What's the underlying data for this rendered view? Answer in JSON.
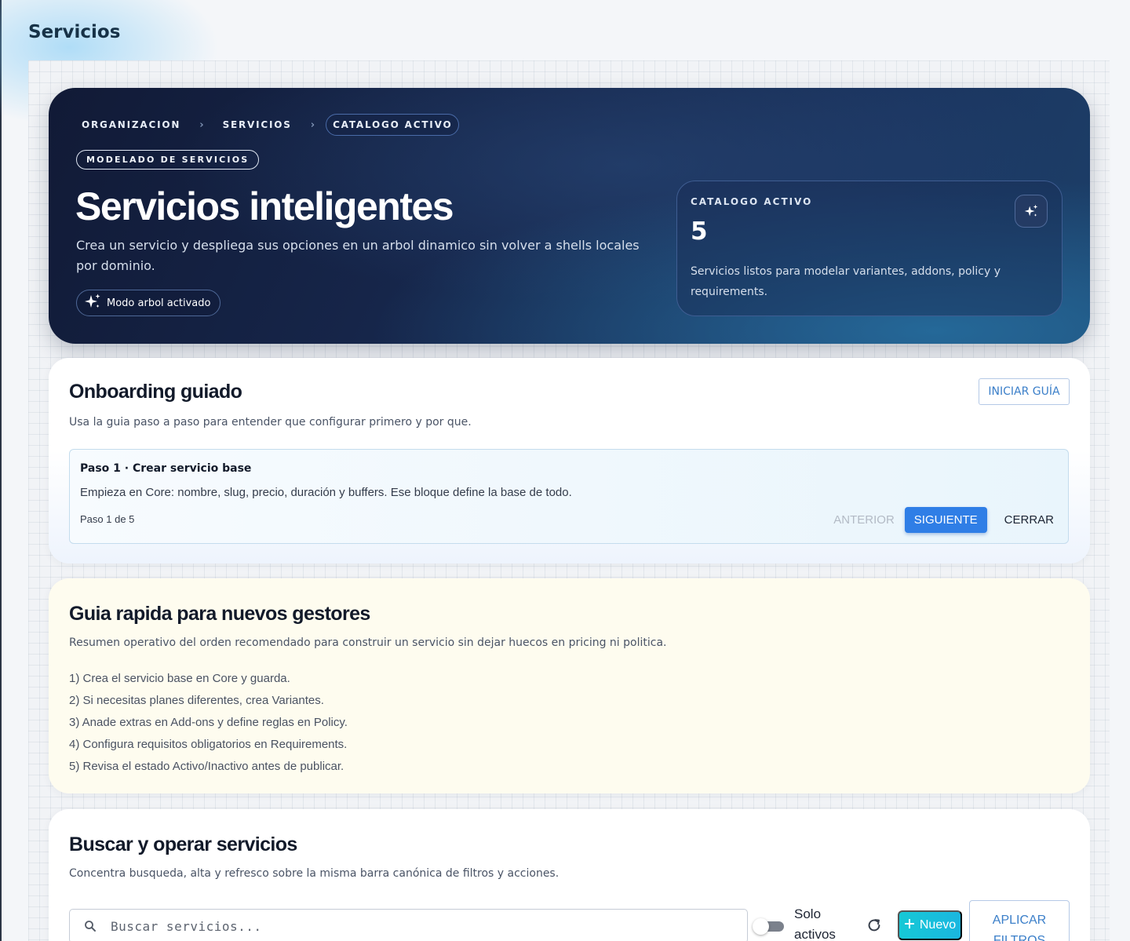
{
  "page": {
    "title": "Servicios"
  },
  "hero": {
    "breadcrumbs": [
      "ORGANIZACION",
      "SERVICIOS",
      "CATALOGO ACTIVO"
    ],
    "eyebrow": "MODELADO DE SERVICIOS",
    "title": "Servicios inteligentes",
    "subtitle": "Crea un servicio y despliega sus opciones en un arbol dinamico sin volver a shells locales por dominio.",
    "mode_pill": {
      "icon": "sparkles-icon",
      "label": "Modo arbol activado"
    },
    "stat": {
      "label": "CATALOGO ACTIVO",
      "value": "5",
      "description": "Servicios listos para modelar variantes, addons, policy y requirements.",
      "icon": "sparkles-icon"
    }
  },
  "onboarding": {
    "title": "Onboarding guiado",
    "subtitle": "Usa la guia paso a paso para entender que configurar primero y por que.",
    "start_label": "INICIAR GUÍA",
    "step": {
      "title": "Paso 1 · Crear servicio base",
      "description": "Empieza en Core: nombre, slug, precio, duración y buffers. Ese bloque define la base de todo.",
      "counter": "Paso 1 de 5",
      "prev_label": "ANTERIOR",
      "next_label": "SIGUIENTE",
      "close_label": "CERRAR"
    }
  },
  "quick_guide": {
    "title": "Guia rapida para nuevos gestores",
    "subtitle": "Resumen operativo del orden recomendado para construir un servicio sin dejar huecos en pricing ni politica.",
    "steps": [
      "1) Crea el servicio base en Core y guarda.",
      "2) Si necesitas planes diferentes, crea Variantes.",
      "3) Anade extras en Add-ons y define reglas en Policy.",
      "4) Configura requisitos obligatorios en Requirements.",
      "5) Revisa el estado Activo/Inactivo antes de publicar."
    ]
  },
  "search": {
    "title": "Buscar y operar servicios",
    "subtitle": "Concentra busqueda, alta y refresco sobre la misma barra canónica de filtros y acciones.",
    "placeholder": "Buscar servicios...",
    "toggle_label": "Solo activos",
    "new_label": "Nuevo",
    "apply_label": "APLICAR FILTROS"
  },
  "colors": {
    "hero_bg": "#17284e",
    "primary_button": "#2f7ee6",
    "new_button": "#16c8d6",
    "link_blue": "#3b7fc9",
    "quick_guide_bg": "#fefcef"
  }
}
